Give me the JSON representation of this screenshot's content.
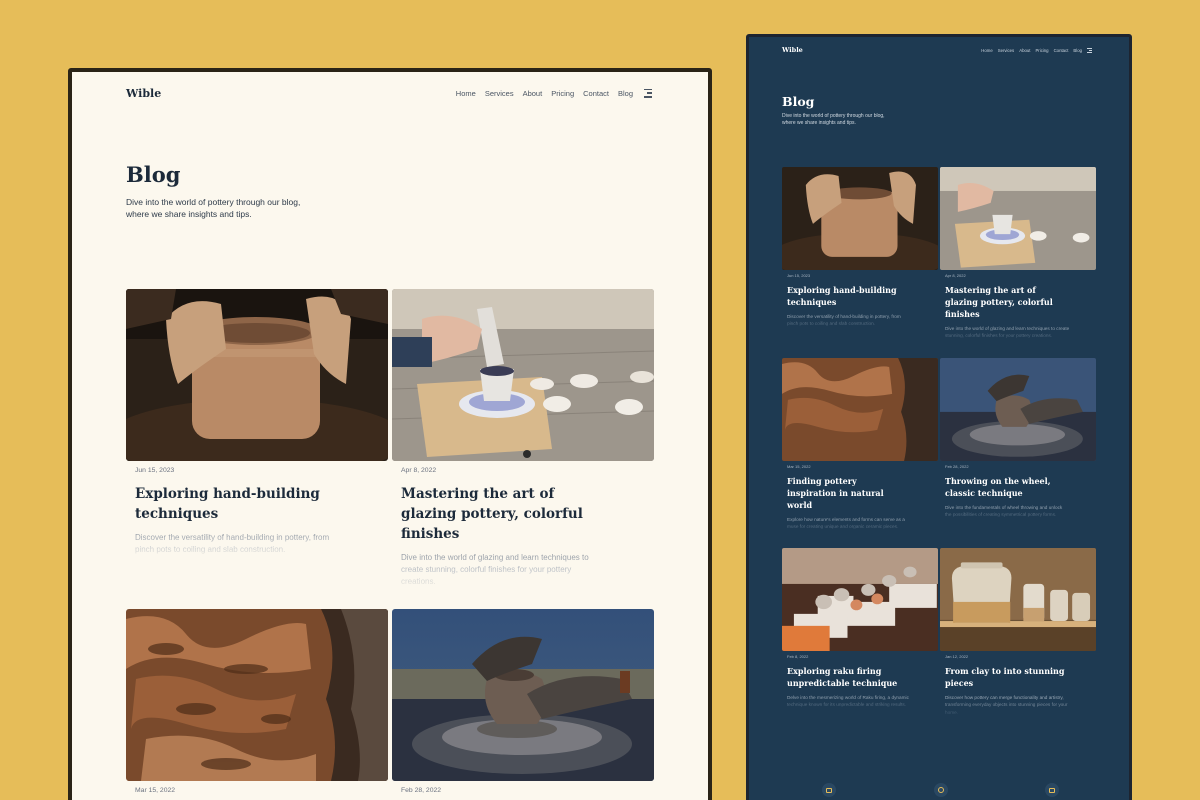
{
  "site": {
    "logo": "Wible",
    "nav": [
      "Home",
      "Services",
      "About",
      "Pricing",
      "Contact",
      "Blog"
    ]
  },
  "page": {
    "title": "Blog",
    "subtitle": "Dive into the world of pottery through our blog, where we share insights and tips."
  },
  "posts": [
    {
      "date": "Jun 15, 2023",
      "title": "Exploring hand-building techniques",
      "desc": "Discover the versatility of hand-building in pottery, from pinch pots to coiling and slab construction."
    },
    {
      "date": "Apr 8, 2022",
      "title": "Mastering the art of glazing pottery, colorful finishes",
      "desc": "Dive into the world of glazing and learn techniques to create stunning, colorful finishes for your pottery creations."
    },
    {
      "date": "Mar 15, 2022",
      "title": "Finding pottery inspiration in natural world",
      "desc": "Explore how nature's elements and forms can serve as a muse for creating unique and organic ceramic pieces."
    },
    {
      "date": "Feb 28, 2022",
      "title": "Throwing on the wheel, classic technique",
      "desc": "Dive into the fundamentals of wheel throwing and unlock the possibilities of creating symmetrical pottery forms."
    },
    {
      "date": "Feb 8, 2022",
      "title": "Exploring raku firing unpredictable technique",
      "desc": "Delve into the mesmerizing world of Raku firing, a dynamic technique known for its unpredictable and striking results."
    },
    {
      "date": "Jan 12, 2022",
      "title": "From clay to into stunning pieces",
      "desc": "Discover how pottery can merge functionality and artistry, transforming everyday objects into stunning pieces for your home."
    }
  ],
  "icons": {
    "menu": "menu-icon",
    "dock": [
      "book-icon",
      "smile-icon",
      "image-icon"
    ]
  },
  "colors": {
    "background": "#e6bd59",
    "light_bg": "#fcf8ee",
    "dark_bg": "#1e3a52",
    "heading": "#1c2a3a"
  }
}
